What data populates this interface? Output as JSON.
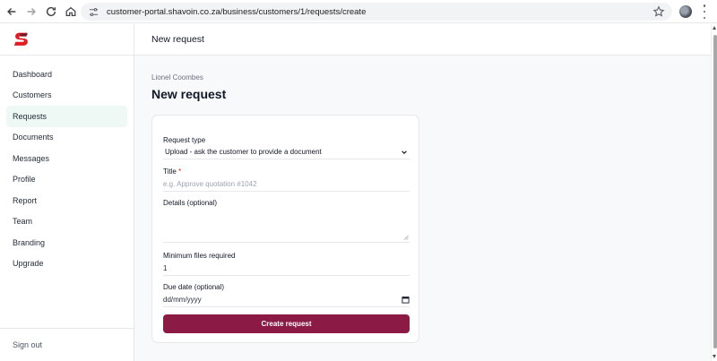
{
  "browser": {
    "url": "customer-portal.shavoin.co.za/business/customers/1/requests/create"
  },
  "brand": {
    "accent": "#8b1a45",
    "logo_color": "#e31b23",
    "active_nav_bg": "#eef8f4"
  },
  "sidebar": {
    "items": [
      {
        "label": "Dashboard",
        "active": false
      },
      {
        "label": "Customers",
        "active": false
      },
      {
        "label": "Requests",
        "active": true
      },
      {
        "label": "Documents",
        "active": false
      },
      {
        "label": "Messages",
        "active": false
      },
      {
        "label": "Profile",
        "active": false
      },
      {
        "label": "Report",
        "active": false
      },
      {
        "label": "Team",
        "active": false
      },
      {
        "label": "Branding",
        "active": false
      },
      {
        "label": "Upgrade",
        "active": false
      }
    ],
    "sign_out": "Sign out"
  },
  "topbar": {
    "title": "New request"
  },
  "main": {
    "breadcrumb": "Lionel Coombes",
    "title": "New request",
    "form": {
      "request_type_label": "Request type",
      "request_type_value": "Upload - ask the customer to provide a document",
      "title_label": "Title",
      "title_required": "*",
      "title_placeholder": "e.g. Approve quotation #1042",
      "details_label": "Details (optional)",
      "min_files_label": "Minimum files required",
      "min_files_value": "1",
      "due_date_label": "Due date (optional)",
      "due_date_placeholder": "dd/mm/yyyy",
      "submit_label": "Create request"
    }
  }
}
